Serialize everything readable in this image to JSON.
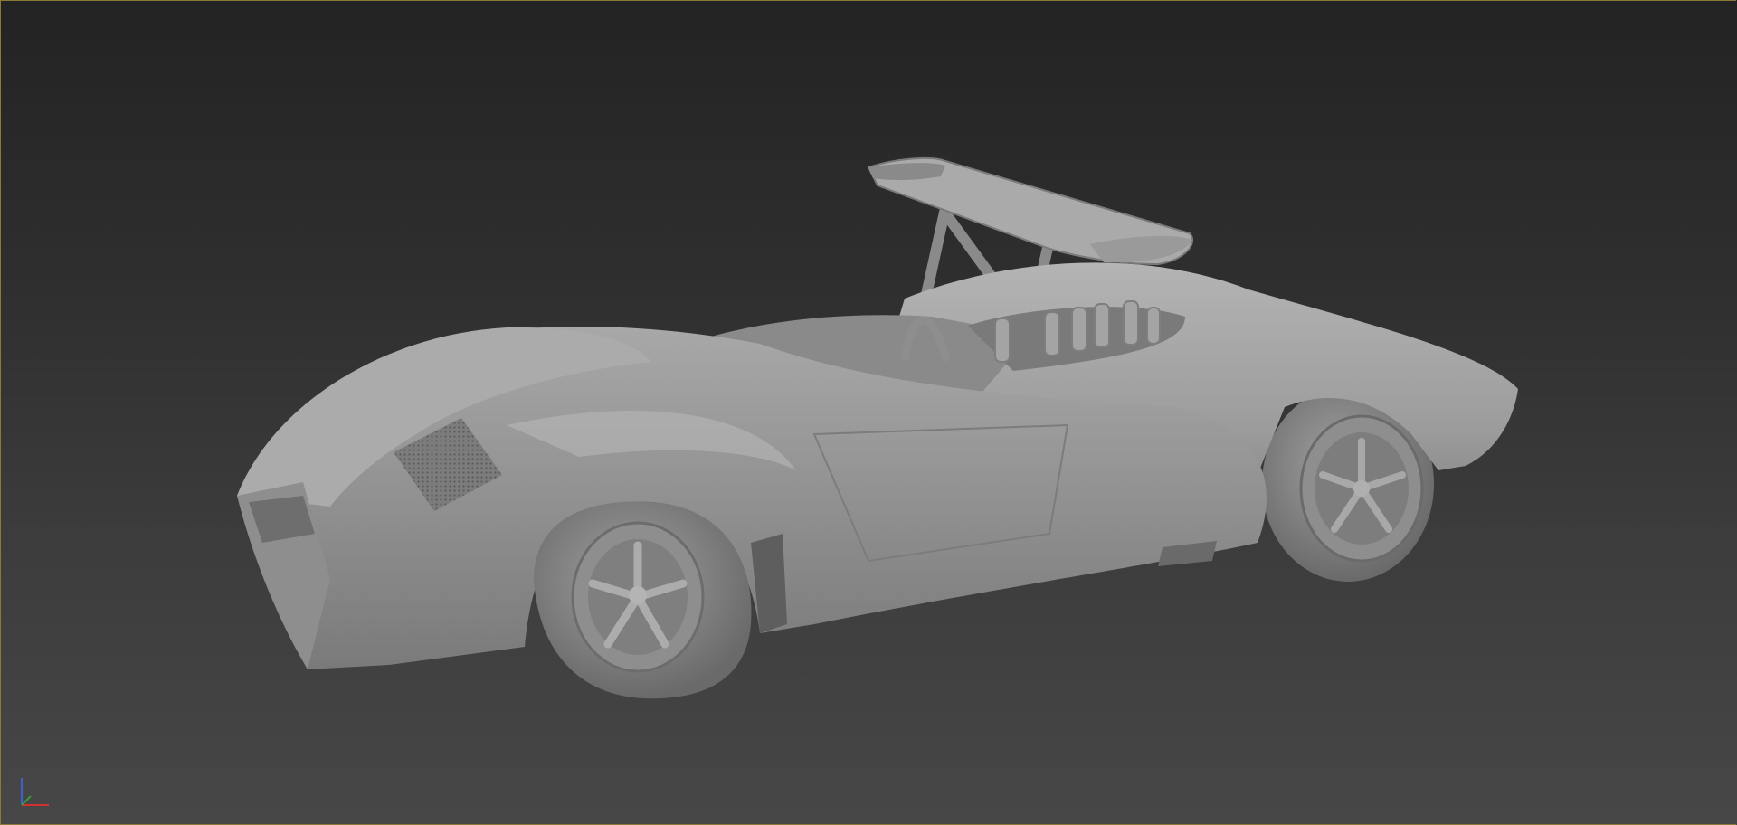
{
  "viewport": {
    "background_top": "#232323",
    "background_bottom": "#474747",
    "active_border_color": "#8a7a3a",
    "shading": "gray clay"
  },
  "model": {
    "name": "race-car-model",
    "body_color": "#9a9a9a"
  },
  "axis_gizmo": {
    "x_color": "#d03030",
    "y_color": "#3a9a3a",
    "z_color": "#4060d0"
  }
}
